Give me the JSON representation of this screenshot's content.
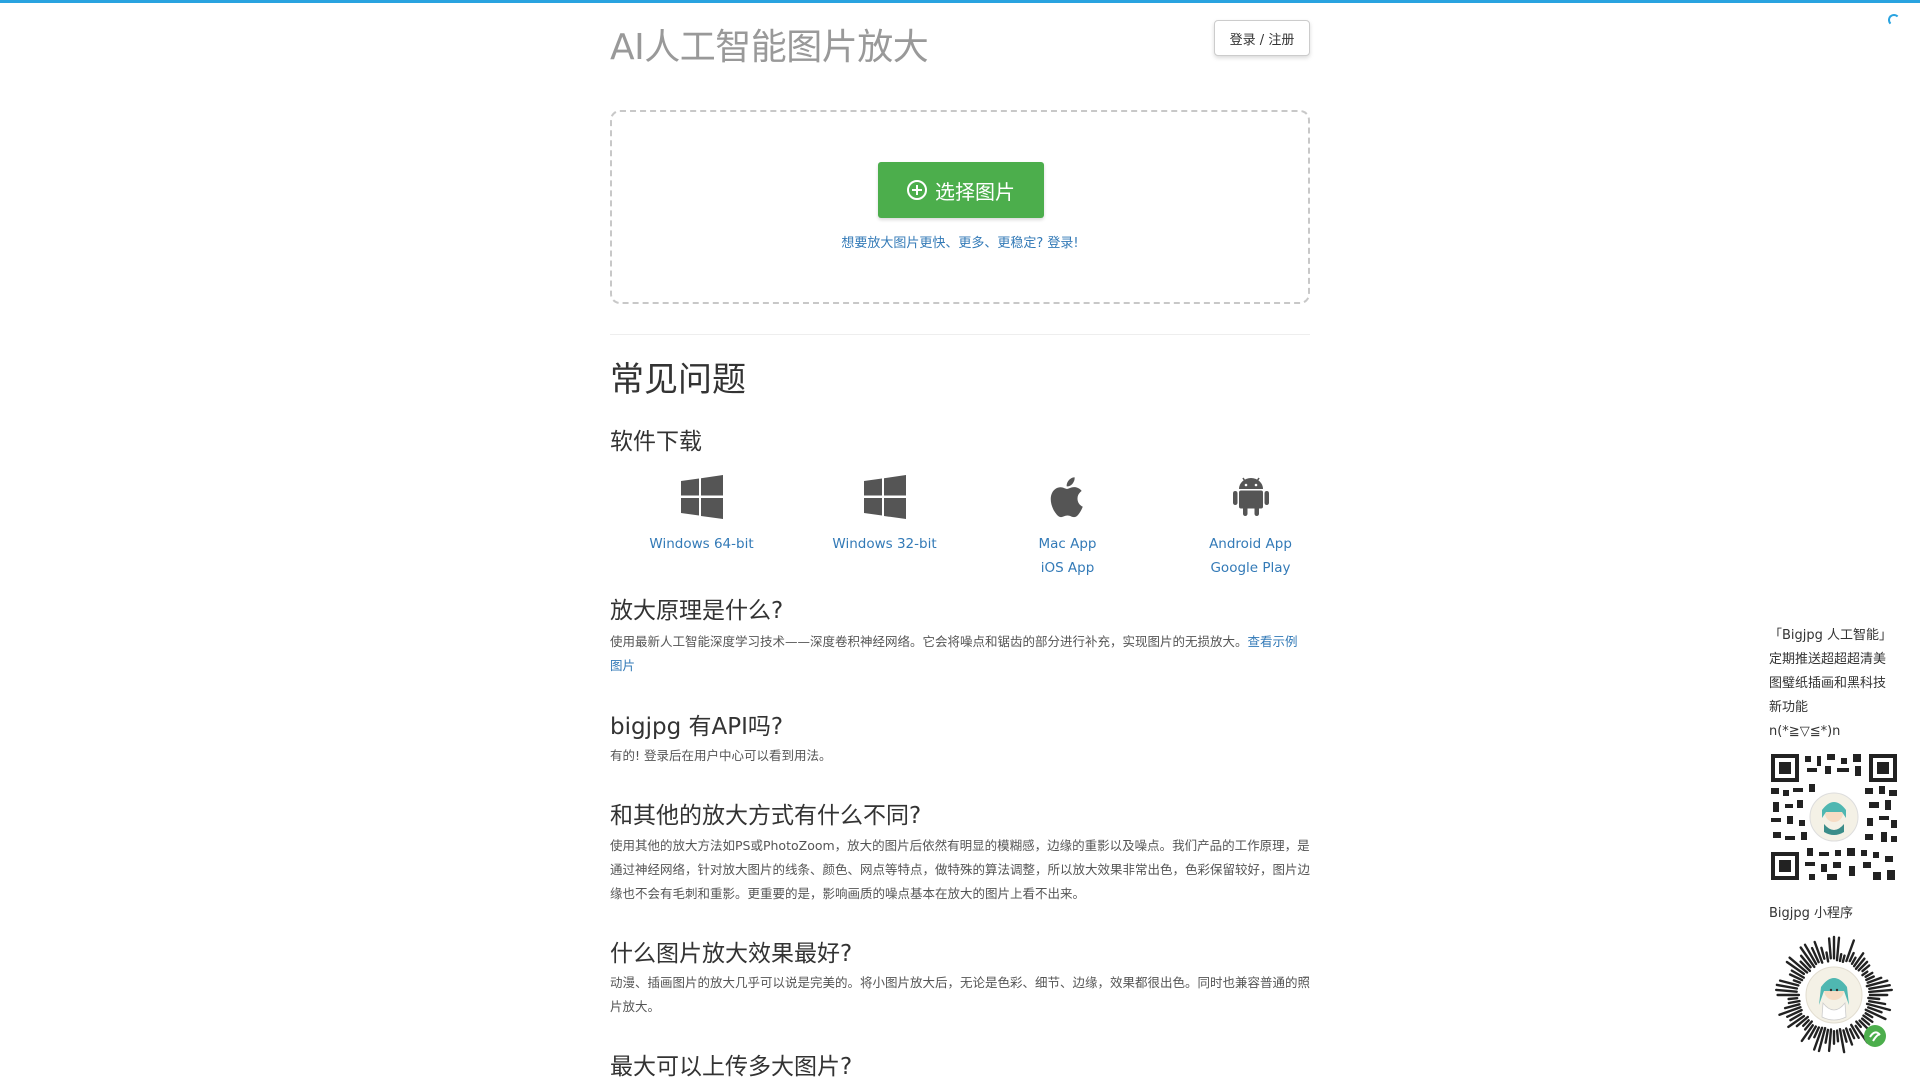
{
  "header": {
    "title": "AI人工智能图片放大",
    "login_label": "登录 / 注册"
  },
  "upload": {
    "select_label": "选择图片",
    "login_hint": "想要放大图片更快、更多、更稳定? 登录!"
  },
  "faq": {
    "title": "常见问题",
    "download": {
      "heading": "软件下载",
      "items": [
        {
          "icon": "windows-icon",
          "links": [
            "Windows 64-bit"
          ]
        },
        {
          "icon": "windows-icon",
          "links": [
            "Windows 32-bit"
          ]
        },
        {
          "icon": "apple-icon",
          "links": [
            "Mac App",
            "iOS App"
          ]
        },
        {
          "icon": "android-icon",
          "links": [
            "Android App",
            "Google Play"
          ]
        }
      ]
    },
    "principle": {
      "heading": "放大原理是什么?",
      "text": "使用最新人工智能深度学习技术——深度卷积神经网络。它会将噪点和锯齿的部分进行补充，实现图片的无损放大。",
      "link": "查看示例图片"
    },
    "api": {
      "heading": "bigjpg 有API吗?",
      "text": "有的! 登录后在用户中心可以看到用法。"
    },
    "difference": {
      "heading": "和其他的放大方式有什么不同?",
      "text": "使用其他的放大方法如PS或PhotoZoom，放大的图片后依然有明显的模糊感，边缘的重影以及噪点。我们产品的工作原理，是通过神经网络，针对放大图片的线条、颜色、网点等特点，做特殊的算法调整，所以放大效果非常出色，色彩保留较好，图片边缘也不会有毛刺和重影。更重要的是，影响画质的噪点基本在放大的图片上看不出来。"
    },
    "best": {
      "heading": "什么图片放大效果最好?",
      "text": "动漫、插画图片的放大几乎可以说是完美的。将小图片放大后，无论是色彩、细节、边缘，效果都很出色。同时也兼容普通的照片放大。"
    },
    "max": {
      "heading": "最大可以上传多大图片?"
    }
  },
  "sidebar": {
    "lines": [
      "「Bigjpg 人工智能」",
      "定期推送超超超清美",
      "图璧纸插画和黑科技",
      "新功能",
      "n(*≧▽≦*)n"
    ],
    "mini_program_label": "Bigjpg 小程序"
  },
  "colors": {
    "accent": "#337ab7",
    "primary_button": "#4cae4c",
    "progress": "#29a3e0"
  }
}
